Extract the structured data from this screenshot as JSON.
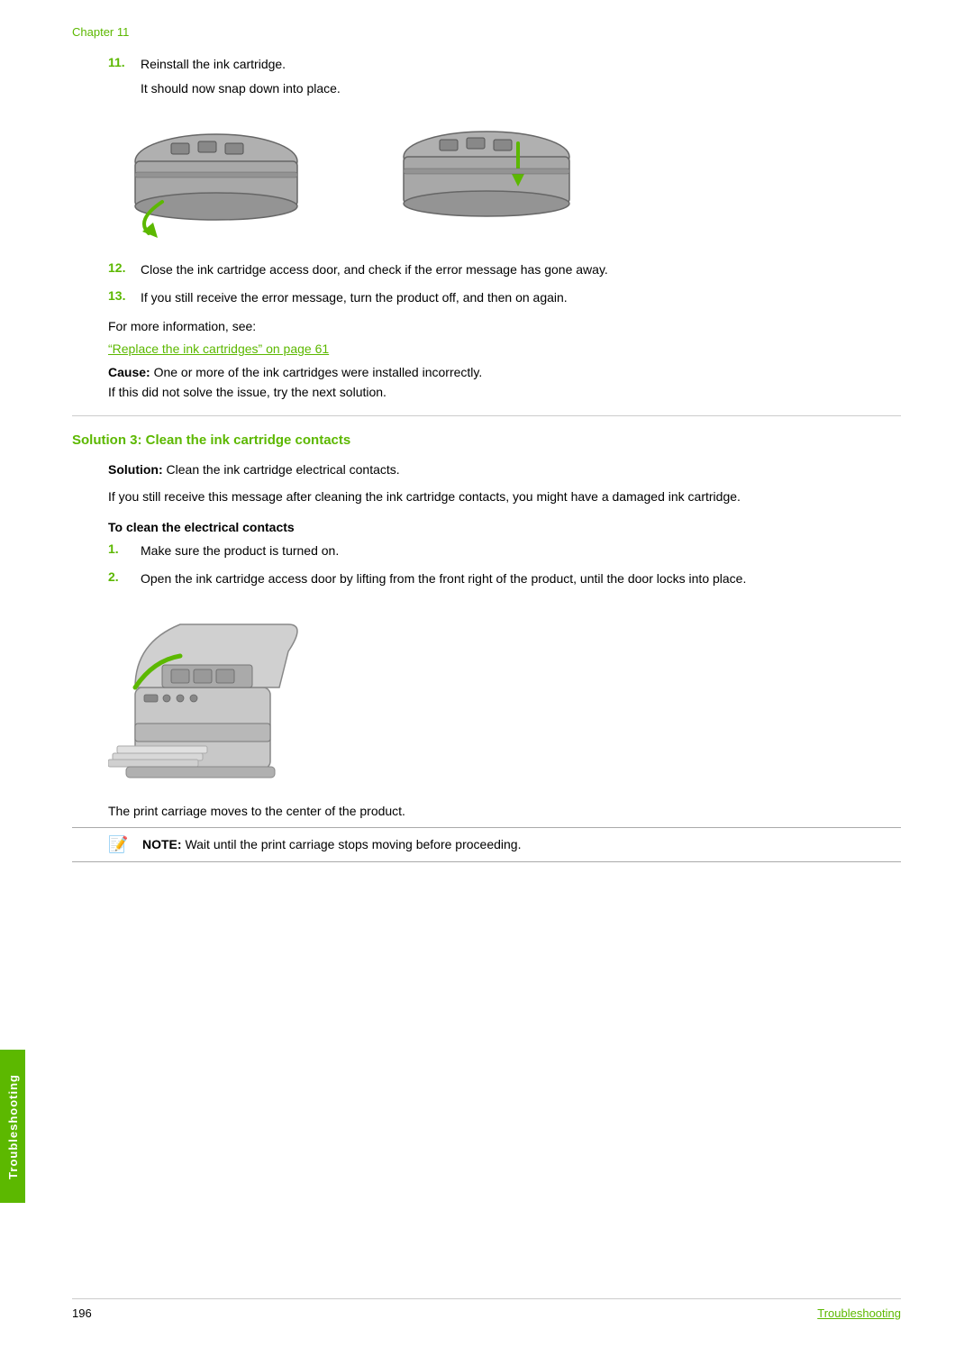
{
  "chapter": {
    "label": "Chapter 11"
  },
  "steps": {
    "step11": {
      "num": "11.",
      "text": "Reinstall the ink cartridge.",
      "subtext": "It should now snap down into place."
    },
    "step12": {
      "num": "12.",
      "text": "Close the ink cartridge access door, and check if the error message has gone away."
    },
    "step13": {
      "num": "13.",
      "text": "If you still receive the error message, turn the product off, and then on again."
    }
  },
  "info_text": "For more information, see:",
  "link_text": "“Replace the ink cartridges” on page 61",
  "cause_label": "Cause:",
  "cause_text": "  One or more of the ink cartridges were installed incorrectly.",
  "not_solve_text": "If this did not solve the issue, try the next solution.",
  "solution3": {
    "heading": "Solution 3: Clean the ink cartridge contacts",
    "solution_label": "Solution:",
    "solution_text": "  Clean the ink cartridge electrical contacts.",
    "description": "If you still receive this message after cleaning the ink cartridge contacts, you might have a damaged ink cartridge.",
    "sub_heading": "To clean the electrical contacts",
    "step1_num": "1.",
    "step1_text": "Make sure the product is turned on.",
    "step2_num": "2.",
    "step2_text": "Open the ink cartridge access door by lifting from the front right of the product, until the door locks into place.",
    "carriage_text": "The print carriage moves to the center of the product.",
    "note_label": "NOTE:",
    "note_text": "  Wait until the print carriage stops moving before proceeding."
  },
  "sidebar": {
    "label": "Troubleshooting"
  },
  "footer": {
    "page_number": "196",
    "link_text": "Troubleshooting"
  }
}
